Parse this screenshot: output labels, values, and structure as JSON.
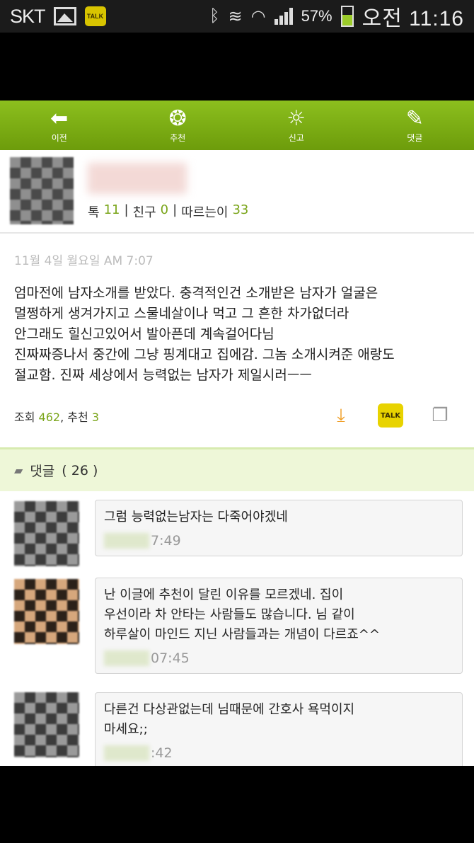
{
  "status_bar": {
    "carrier": "SKT",
    "battery_percent": "57%",
    "battery_level": 0.57,
    "clock": "오전 11:16",
    "icons": [
      "gallery-icon",
      "kakaotalk-icon",
      "bluetooth-icon",
      "vibrate-icon",
      "wifi-icon",
      "signal-icon",
      "battery-icon"
    ]
  },
  "toolbar": {
    "items": [
      {
        "label": "이전",
        "icon": "back-arrow-icon"
      },
      {
        "label": "추천",
        "icon": "medal-icon"
      },
      {
        "label": "신고",
        "icon": "siren-icon"
      },
      {
        "label": "댓글",
        "icon": "comment-pencil-icon"
      }
    ]
  },
  "profile": {
    "stats": {
      "label1": "톡",
      "val1": "11",
      "label2": "친구",
      "val2": "0",
      "label3": "따르는이",
      "val3": "33"
    }
  },
  "post": {
    "date": "11월 4일 월요일 AM 7:07",
    "body": "엄마전에 남자소개를 받았다. 충격적인건 소개받은 남자가 얼굴은\n멀쩡하게 생겨가지고 스물네살이나 먹고 그 흔한 차가없더라\n안그래도 힐신고있어서 발아픈데 계속걸어다님\n진짜짜증나서 중간에 그냥 핑계대고 집에감. 그놈 소개시켜준 애랑도\n절교함. 진짜 세상에서 능력없는 남자가 제일시러ㅡㅡ",
    "views_label": "조회",
    "views": "462",
    "recommend_label": "추천",
    "recommend": "3"
  },
  "comments_header": {
    "label": "댓글",
    "count": "( 26 )"
  },
  "comments": [
    {
      "text": "그럼 능력없는남자는 다죽어야겠네",
      "time": "7:49"
    },
    {
      "text": "난 이글에 추천이 달린 이유를 모르겠네. 집이\n우선이라 차 안타는 사람들도 많습니다. 님 같이\n하루살이 마인드 지닌 사람들과는 개념이 다르죠^^",
      "time": "07:45"
    },
    {
      "text": "다른건 다상관없는데 님때문에 간호사 욕먹이지\n마세요;;",
      "time": ":42"
    }
  ]
}
